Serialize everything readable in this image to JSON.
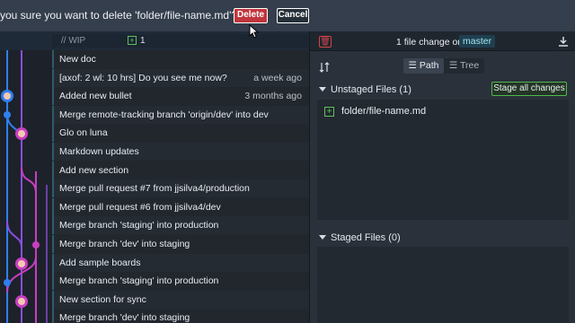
{
  "confirm": {
    "message": "you sure you want to delete 'folder/file-name.md'?",
    "delete_label": "Delete",
    "cancel_label": "Cancel"
  },
  "graph": {
    "wip_label": "// WIP",
    "wip_count": "1",
    "commits": [
      {
        "message": "New doc",
        "time": ""
      },
      {
        "message": "[axof: 2 wl: 10 hrs] Do you see me now?",
        "time": "a week ago"
      },
      {
        "message": "Added new bullet",
        "time": "3 months ago"
      },
      {
        "message": "Merge remote-tracking branch 'origin/dev' into dev",
        "time": ""
      },
      {
        "message": "Glo on luna",
        "time": ""
      },
      {
        "message": "Markdown updates",
        "time": ""
      },
      {
        "message": "Add new section",
        "time": ""
      },
      {
        "message": "Merge pull request #7 from jjsilva4/production",
        "time": ""
      },
      {
        "message": "Merge pull request #6 from jjsilva4/dev",
        "time": ""
      },
      {
        "message": "Merge branch 'staging' into production",
        "time": ""
      },
      {
        "message": "Merge branch 'dev' into staging",
        "time": ""
      },
      {
        "message": "Add sample boards",
        "time": ""
      },
      {
        "message": "Merge branch 'staging' into production",
        "time": ""
      },
      {
        "message": "New section for sync",
        "time": ""
      },
      {
        "message": "Merge branch 'dev' into staging",
        "time": ""
      }
    ]
  },
  "panel": {
    "changes_text": "1 file change on",
    "branch": "master",
    "path_label": "Path",
    "tree_label": "Tree",
    "unstaged_title": "Unstaged Files (1)",
    "stage_all_label": "Stage all changes",
    "unstaged_files": [
      "folder/file-name.md"
    ],
    "staged_title": "Staged Files (0)"
  },
  "colors": {
    "delete": "#c1353c",
    "stage_green": "#51b84f",
    "lane_blue": "#2f7ff0",
    "lane_magenta": "#c83ec2",
    "lane_purple": "#8b4de0",
    "branch_text": "#9ee7f0"
  }
}
